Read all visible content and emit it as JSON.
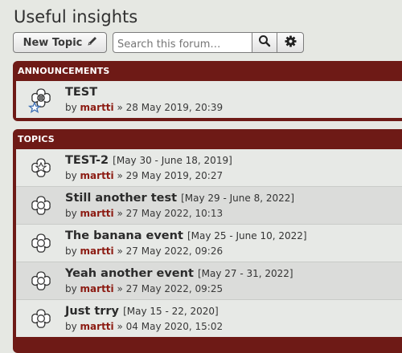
{
  "page_title": "Useful insights",
  "toolbar": {
    "new_topic_label": "New Topic",
    "new_topic_icon": "pencil-icon",
    "search_placeholder": "Search this forum…",
    "search_icon": "search-icon",
    "settings_icon": "gear-icon"
  },
  "announcements": {
    "header": "ANNOUNCEMENTS",
    "items": [
      {
        "title": "TEST",
        "by": "by",
        "author": "martti",
        "sep": "»",
        "date": "28 May 2019, 20:39",
        "icon": "flower-hatched-star-icon"
      }
    ]
  },
  "topics": {
    "header": "TOPICS",
    "items": [
      {
        "title": "TEST-2",
        "dates": "[May 30 - June 18, 2019]",
        "by": "by",
        "author": "martti",
        "sep": "»",
        "date": "29 May 2019, 20:27",
        "icon": "star-outline-icon"
      },
      {
        "title": "Still another test",
        "dates": "[May 29 - June 8, 2022]",
        "by": "by",
        "author": "martti",
        "sep": "»",
        "date": "27 May 2022, 10:13",
        "icon": "flower-outline-icon"
      },
      {
        "title": "The banana event",
        "dates": "[May 25 - June 10, 2022]",
        "by": "by",
        "author": "martti",
        "sep": "»",
        "date": "27 May 2022, 09:26",
        "icon": "flower-outline-icon"
      },
      {
        "title": "Yeah another event",
        "dates": "[May 27 - 31, 2022]",
        "by": "by",
        "author": "martti",
        "sep": "»",
        "date": "27 May 2022, 09:25",
        "icon": "flower-outline-icon"
      },
      {
        "title": "Just trry",
        "dates": "[May 15 - 22, 2020]",
        "by": "by",
        "author": "martti",
        "sep": "»",
        "date": "04 May 2020, 15:02",
        "icon": "flower-outline-icon"
      }
    ]
  },
  "colors": {
    "panel": "#6e1a16",
    "author": "#8c1b12",
    "background": "#e6e8e3"
  }
}
